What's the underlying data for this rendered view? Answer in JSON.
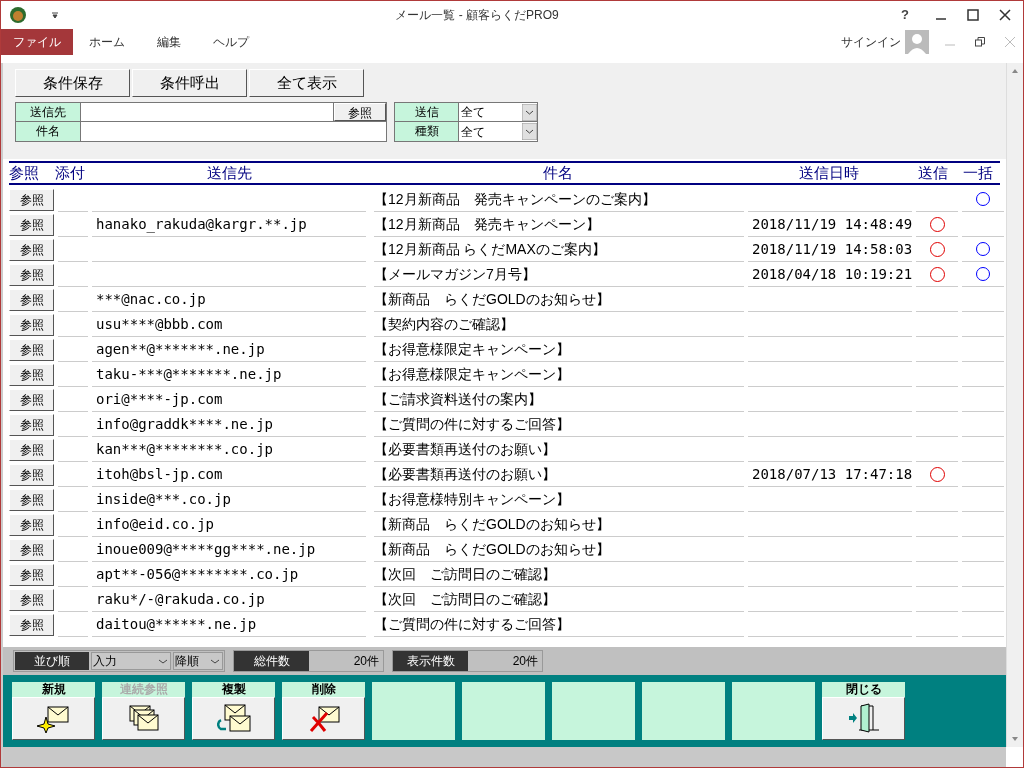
{
  "window": {
    "title": "メール一覧 - 顧客らくだPRO9",
    "help": "?"
  },
  "menu": [
    {
      "label": "ファイル",
      "selected": true
    },
    {
      "label": "ホーム",
      "selected": false
    },
    {
      "label": "編集",
      "selected": false
    },
    {
      "label": "ヘルプ",
      "selected": false
    }
  ],
  "signin": "サインイン",
  "toolbar": [
    "条件保存",
    "条件呼出",
    "全て表示"
  ],
  "filters": {
    "to_label": "送信先",
    "ref_button": "参照",
    "subject_label": "件名",
    "sent_label": "送信",
    "sent_value": "全て",
    "type_label": "種類",
    "type_value": "全て"
  },
  "table": {
    "columns": [
      "参照",
      "添付",
      "送信先",
      "件名",
      "送信日時",
      "送信",
      "一括"
    ],
    "rows": [
      {
        "ref": "参照",
        "to": "",
        "subject": "【12月新商品　発売キャンペーンのご案内】",
        "date": "",
        "sent": false,
        "bulk": true
      },
      {
        "ref": "参照",
        "to": "hanako_rakuda@kargr.**.jp",
        "subject": "【12月新商品　発売キャンペーン】",
        "date": "2018/11/19 14:48:49",
        "sent": true,
        "bulk": false
      },
      {
        "ref": "参照",
        "to": "",
        "subject": "【12月新商品 らくだMAXのご案内】",
        "date": "2018/11/19 14:58:03",
        "sent": true,
        "bulk": true
      },
      {
        "ref": "参照",
        "to": "",
        "subject": "【メールマガジン7月号】",
        "date": "2018/04/18 10:19:21",
        "sent": true,
        "bulk": true
      },
      {
        "ref": "参照",
        "to": "***@nac.co.jp",
        "subject": "【新商品　らくだGOLDのお知らせ】",
        "date": "",
        "sent": false,
        "bulk": false
      },
      {
        "ref": "参照",
        "to": "usu****@bbb.com",
        "subject": "【契約内容のご確認】",
        "date": "",
        "sent": false,
        "bulk": false
      },
      {
        "ref": "参照",
        "to": "agen**@*******.ne.jp",
        "subject": "【お得意様限定キャンペーン】",
        "date": "",
        "sent": false,
        "bulk": false
      },
      {
        "ref": "参照",
        "to": "taku-***@*******.ne.jp",
        "subject": "【お得意様限定キャンペーン】",
        "date": "",
        "sent": false,
        "bulk": false
      },
      {
        "ref": "参照",
        "to": "ori@****-jp.com",
        "subject": "【ご請求資料送付の案内】",
        "date": "",
        "sent": false,
        "bulk": false
      },
      {
        "ref": "参照",
        "to": "info@graddk****.ne.jp",
        "subject": "【ご質問の件に対するご回答】",
        "date": "",
        "sent": false,
        "bulk": false
      },
      {
        "ref": "参照",
        "to": "kan***@********.co.jp",
        "subject": "【必要書類再送付のお願い】",
        "date": "",
        "sent": false,
        "bulk": false
      },
      {
        "ref": "参照",
        "to": "itoh@bsl-jp.com",
        "subject": "【必要書類再送付のお願い】",
        "date": "2018/07/13 17:47:18",
        "sent": true,
        "bulk": false
      },
      {
        "ref": "参照",
        "to": "inside@***.co.jp",
        "subject": "【お得意様特別キャンペーン】",
        "date": "",
        "sent": false,
        "bulk": false
      },
      {
        "ref": "参照",
        "to": "info@eid.co.jp",
        "subject": "【新商品　らくだGOLDのお知らせ】",
        "date": "",
        "sent": false,
        "bulk": false
      },
      {
        "ref": "参照",
        "to": "inoue009@*****gg****.ne.jp",
        "subject": "【新商品　らくだGOLDのお知らせ】",
        "date": "",
        "sent": false,
        "bulk": false
      },
      {
        "ref": "参照",
        "to": "apt**-056@********.co.jp",
        "subject": "【次回　ご訪問日のご確認】",
        "date": "",
        "sent": false,
        "bulk": false
      },
      {
        "ref": "参照",
        "to": "raku*/-@rakuda.co.jp",
        "subject": "【次回　ご訪問日のご確認】",
        "date": "",
        "sent": false,
        "bulk": false
      },
      {
        "ref": "参照",
        "to": "daitou@******.ne.jp",
        "subject": "【ご質問の件に対するご回答】",
        "date": "",
        "sent": false,
        "bulk": false
      }
    ]
  },
  "status": {
    "sort_label": "並び順",
    "sort_value": "入力",
    "order_value": "降順",
    "total_label": "総件数",
    "total_value": "20件",
    "shown_label": "表示件数",
    "shown_value": "20件"
  },
  "actions": [
    {
      "kind": "new",
      "label": "新規",
      "disabled": false
    },
    {
      "kind": "multi",
      "label": "連続参照",
      "disabled": true
    },
    {
      "kind": "copy",
      "label": "複製",
      "disabled": false
    },
    {
      "kind": "delete",
      "label": "削除",
      "disabled": false
    },
    {
      "kind": "empty"
    },
    {
      "kind": "empty"
    },
    {
      "kind": "empty"
    },
    {
      "kind": "empty"
    },
    {
      "kind": "empty"
    },
    {
      "kind": "close",
      "label": "閉じる",
      "disabled": false
    }
  ]
}
